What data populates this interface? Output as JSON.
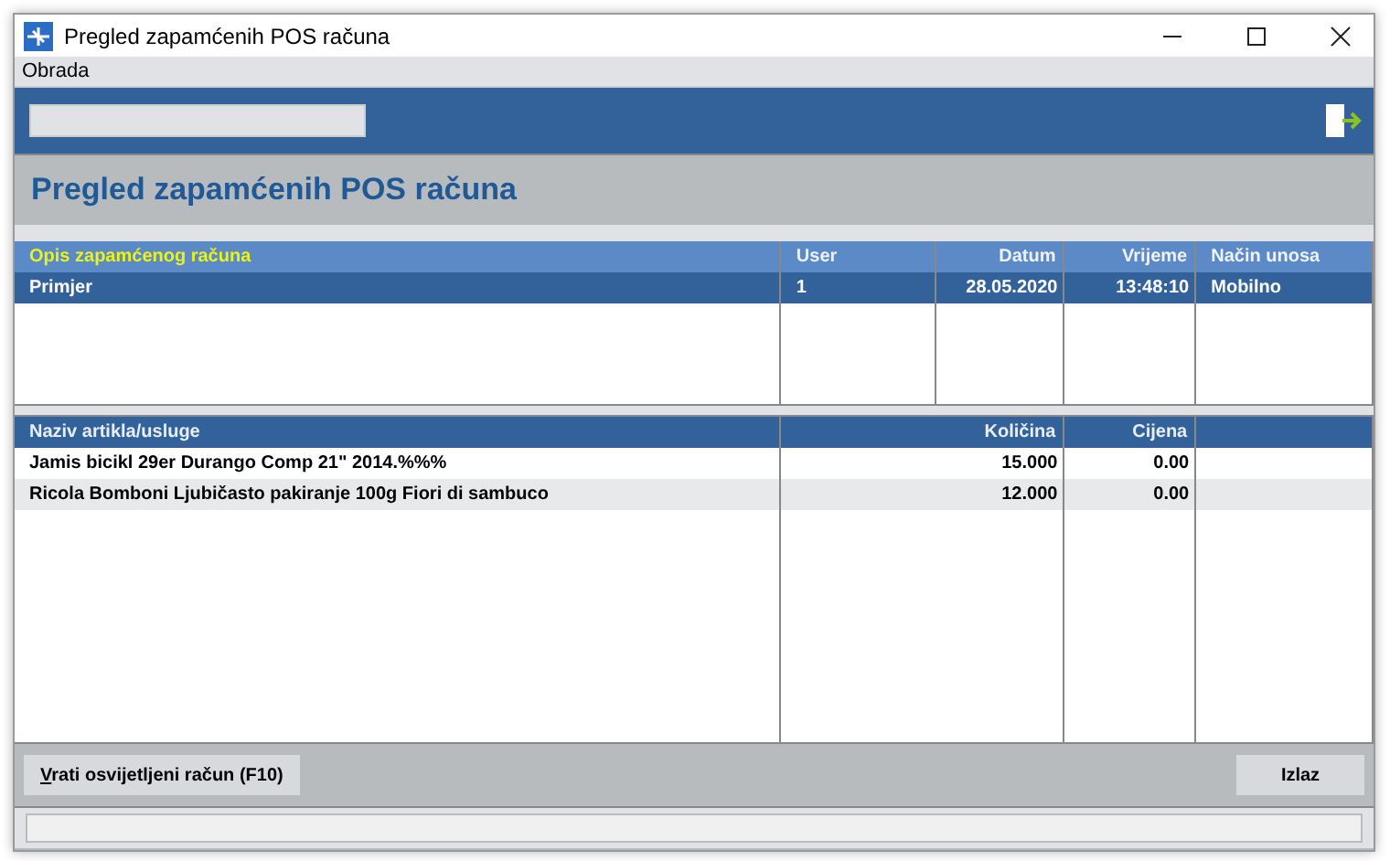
{
  "window": {
    "title": "Pregled zapamćenih POS računa"
  },
  "menu": [
    "Obrada"
  ],
  "heading": "Pregled zapamćenih POS računa",
  "receipts": {
    "columns": [
      "Opis zapamćenog računa",
      "User",
      "Datum",
      "Vrijeme",
      "Način unosa"
    ],
    "rows": [
      {
        "selected": true,
        "cells": [
          "Primjer",
          "1",
          "28.05.2020",
          "13:48:10",
          "Mobilno"
        ]
      }
    ]
  },
  "items": {
    "columns": [
      "Naziv artikla/usluge",
      "Količina",
      "Cijena"
    ],
    "rows": [
      {
        "cells": [
          "Jamis bicikl 29er Durango Comp 21\" 2014.%%%",
          "15.000",
          "0.00"
        ]
      },
      {
        "cells": [
          "Ricola Bomboni Ljubičasto pakiranje 100g Fiori di sambuco",
          "12.000",
          "0.00"
        ]
      }
    ]
  },
  "buttons": [
    {
      "label": "Vrati osvijetljeni račun (F10)"
    },
    {
      "label": "Izlaz"
    }
  ]
}
